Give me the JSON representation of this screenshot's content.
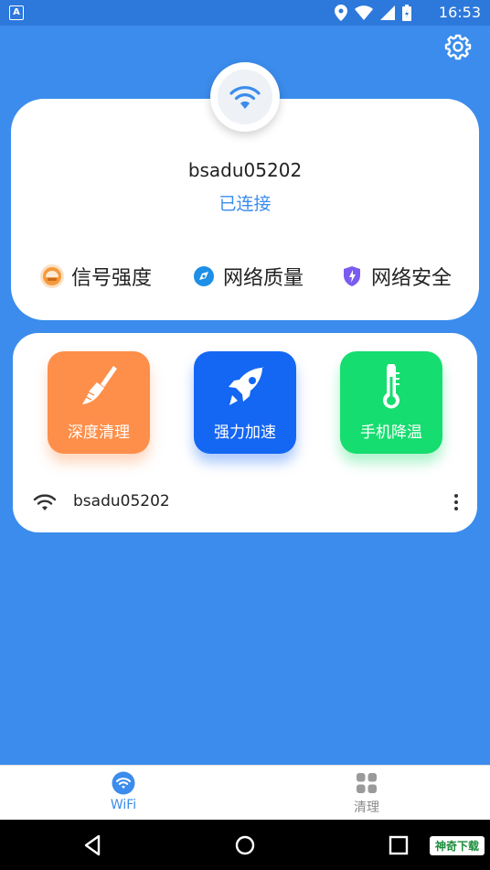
{
  "status_bar": {
    "time": "16:53",
    "app_icon": "A"
  },
  "header": {
    "settings_icon": "gear-icon"
  },
  "connection": {
    "ssid": "bsadu05202",
    "status": "已连接",
    "badge_icon": "wifi-icon"
  },
  "features": [
    {
      "label": "信号强度",
      "icon": "signal-strength-icon"
    },
    {
      "label": "网络质量",
      "icon": "network-quality-icon"
    },
    {
      "label": "网络安全",
      "icon": "network-security-icon"
    }
  ],
  "tools": [
    {
      "label": "深度清理",
      "icon": "broom-icon",
      "color": "#fd8f4b"
    },
    {
      "label": "强力加速",
      "icon": "rocket-icon",
      "color": "#1467f3"
    },
    {
      "label": "手机降温",
      "icon": "thermometer-icon",
      "color": "#16dd6f"
    }
  ],
  "network_list": [
    {
      "name": "bsadu05202",
      "icon": "wifi-icon"
    }
  ],
  "tabs": [
    {
      "label": "WiFi",
      "icon": "wifi-icon",
      "active": true
    },
    {
      "label": "清理",
      "icon": "grid-icon",
      "active": false
    }
  ],
  "watermark": "神奇下载",
  "colors": {
    "primary": "#3b8cec",
    "orange": "#fd8f4b",
    "blue": "#1467f3",
    "green": "#16dd6f"
  }
}
